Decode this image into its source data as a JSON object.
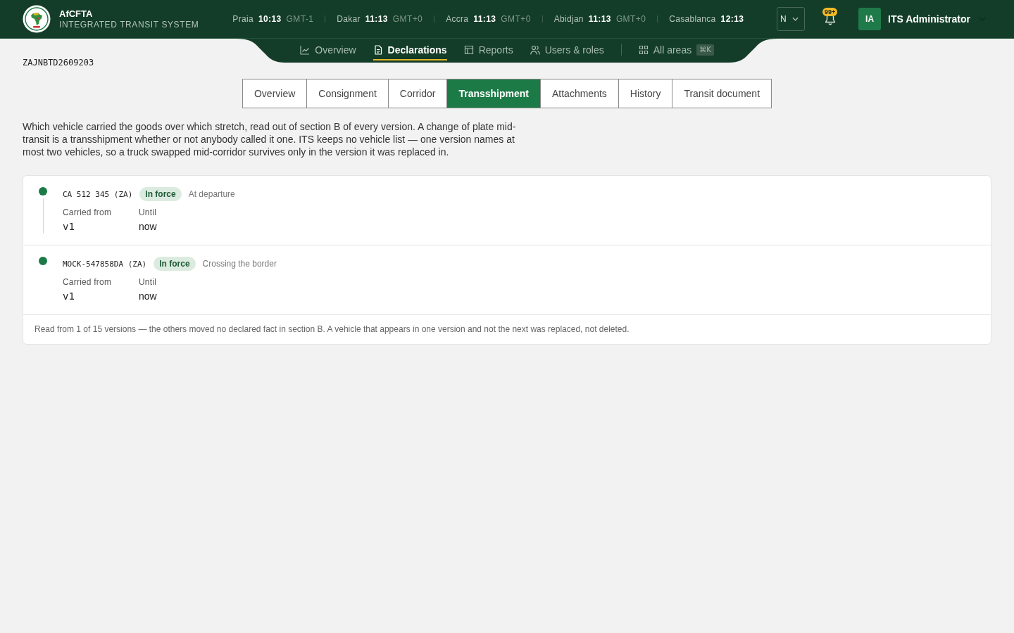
{
  "header": {
    "logo": {
      "title": "AfCFTA",
      "subtitle": "INTEGRATED TRANSIT SYSTEM"
    },
    "clocks": [
      {
        "city": "Praia",
        "time": "10:13",
        "zone": "GMT-1"
      },
      {
        "city": "Dakar",
        "time": "11:13",
        "zone": "GMT+0"
      },
      {
        "city": "Accra",
        "time": "11:13",
        "zone": "GMT+0"
      },
      {
        "city": "Abidjan",
        "time": "11:13",
        "zone": "GMT+0"
      },
      {
        "city": "Casablanca",
        "time": "12:13"
      }
    ],
    "language": "N",
    "notifications": "99+",
    "user": {
      "initials": "IA",
      "name": "ITS Administrator"
    }
  },
  "nav": {
    "items": [
      {
        "label": "Overview",
        "selected": false
      },
      {
        "label": "Declarations",
        "selected": true
      },
      {
        "label": "Reports",
        "selected": false
      },
      {
        "label": "Users & roles",
        "selected": false
      }
    ],
    "all_areas": {
      "label": "All areas",
      "shortcut": "⌘K"
    }
  },
  "document_id": "ZAJNBTD2609203",
  "tabs": [
    {
      "label": "Overview",
      "selected": false
    },
    {
      "label": "Consignment",
      "selected": false
    },
    {
      "label": "Corridor",
      "selected": false
    },
    {
      "label": "Transshipment",
      "selected": true
    },
    {
      "label": "Attachments",
      "selected": false
    },
    {
      "label": "History",
      "selected": false
    },
    {
      "label": "Transit document",
      "selected": false
    }
  ],
  "description": "Which vehicle carried the goods over which stretch, read out of section B of every version. A change of plate mid-transit is a transshipment whether or not anybody called it one. ITS keeps no vehicle list — one version names at most two vehicles, so a truck swapped mid-corridor survives only in the version it was replaced in.",
  "vehicles": [
    {
      "plate": "CA 512 345 (ZA)",
      "status": "In force",
      "stage": "At departure",
      "fields": [
        {
          "label": "Carried from",
          "value": "v1",
          "kind": "version"
        },
        {
          "label": "Until",
          "value": "now",
          "kind": "text"
        }
      ]
    },
    {
      "plate": "MOCK-547858DA (ZA)",
      "status": "In force",
      "stage": "Crossing the border",
      "fields": [
        {
          "label": "Carried from",
          "value": "v1",
          "kind": "version"
        },
        {
          "label": "Until",
          "value": "now",
          "kind": "text"
        }
      ]
    }
  ],
  "footnote": "Read from 1 of 15 versions — the others moved no declared fact in section B. A vehicle that appears in one version and not the next was replaced, not deleted."
}
